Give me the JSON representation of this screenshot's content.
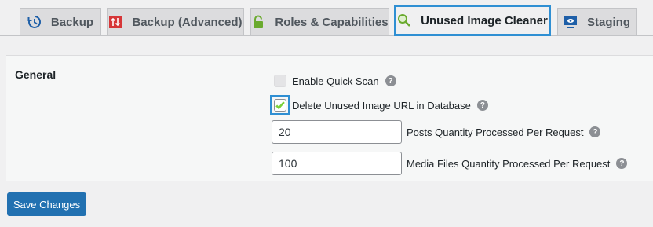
{
  "tabs": [
    {
      "label": "Backup",
      "icon": "history-icon"
    },
    {
      "label": "Backup (Advanced)",
      "icon": "transfer-icon"
    },
    {
      "label": "Roles & Capabilities",
      "icon": "lock-icon"
    },
    {
      "label": "Unused Image Cleaner",
      "icon": "search-icon",
      "active": true
    },
    {
      "label": "Staging",
      "icon": "screen-icon"
    }
  ],
  "colors": {
    "accent": "#2f8fd3",
    "button": "#2271b1",
    "check": "#7ad03a"
  },
  "section": {
    "label": "General"
  },
  "settings": {
    "quick_scan": {
      "label": "Enable Quick Scan",
      "checked": false
    },
    "delete_url": {
      "label": "Delete Unused Image URL in Database",
      "checked": true
    },
    "posts_qty": {
      "value": "20",
      "label": "Posts Quantity Processed Per Request"
    },
    "media_qty": {
      "value": "100",
      "label": "Media Files Quantity Processed Per Request"
    }
  },
  "help_glyph": "?",
  "save_label": "Save Changes"
}
